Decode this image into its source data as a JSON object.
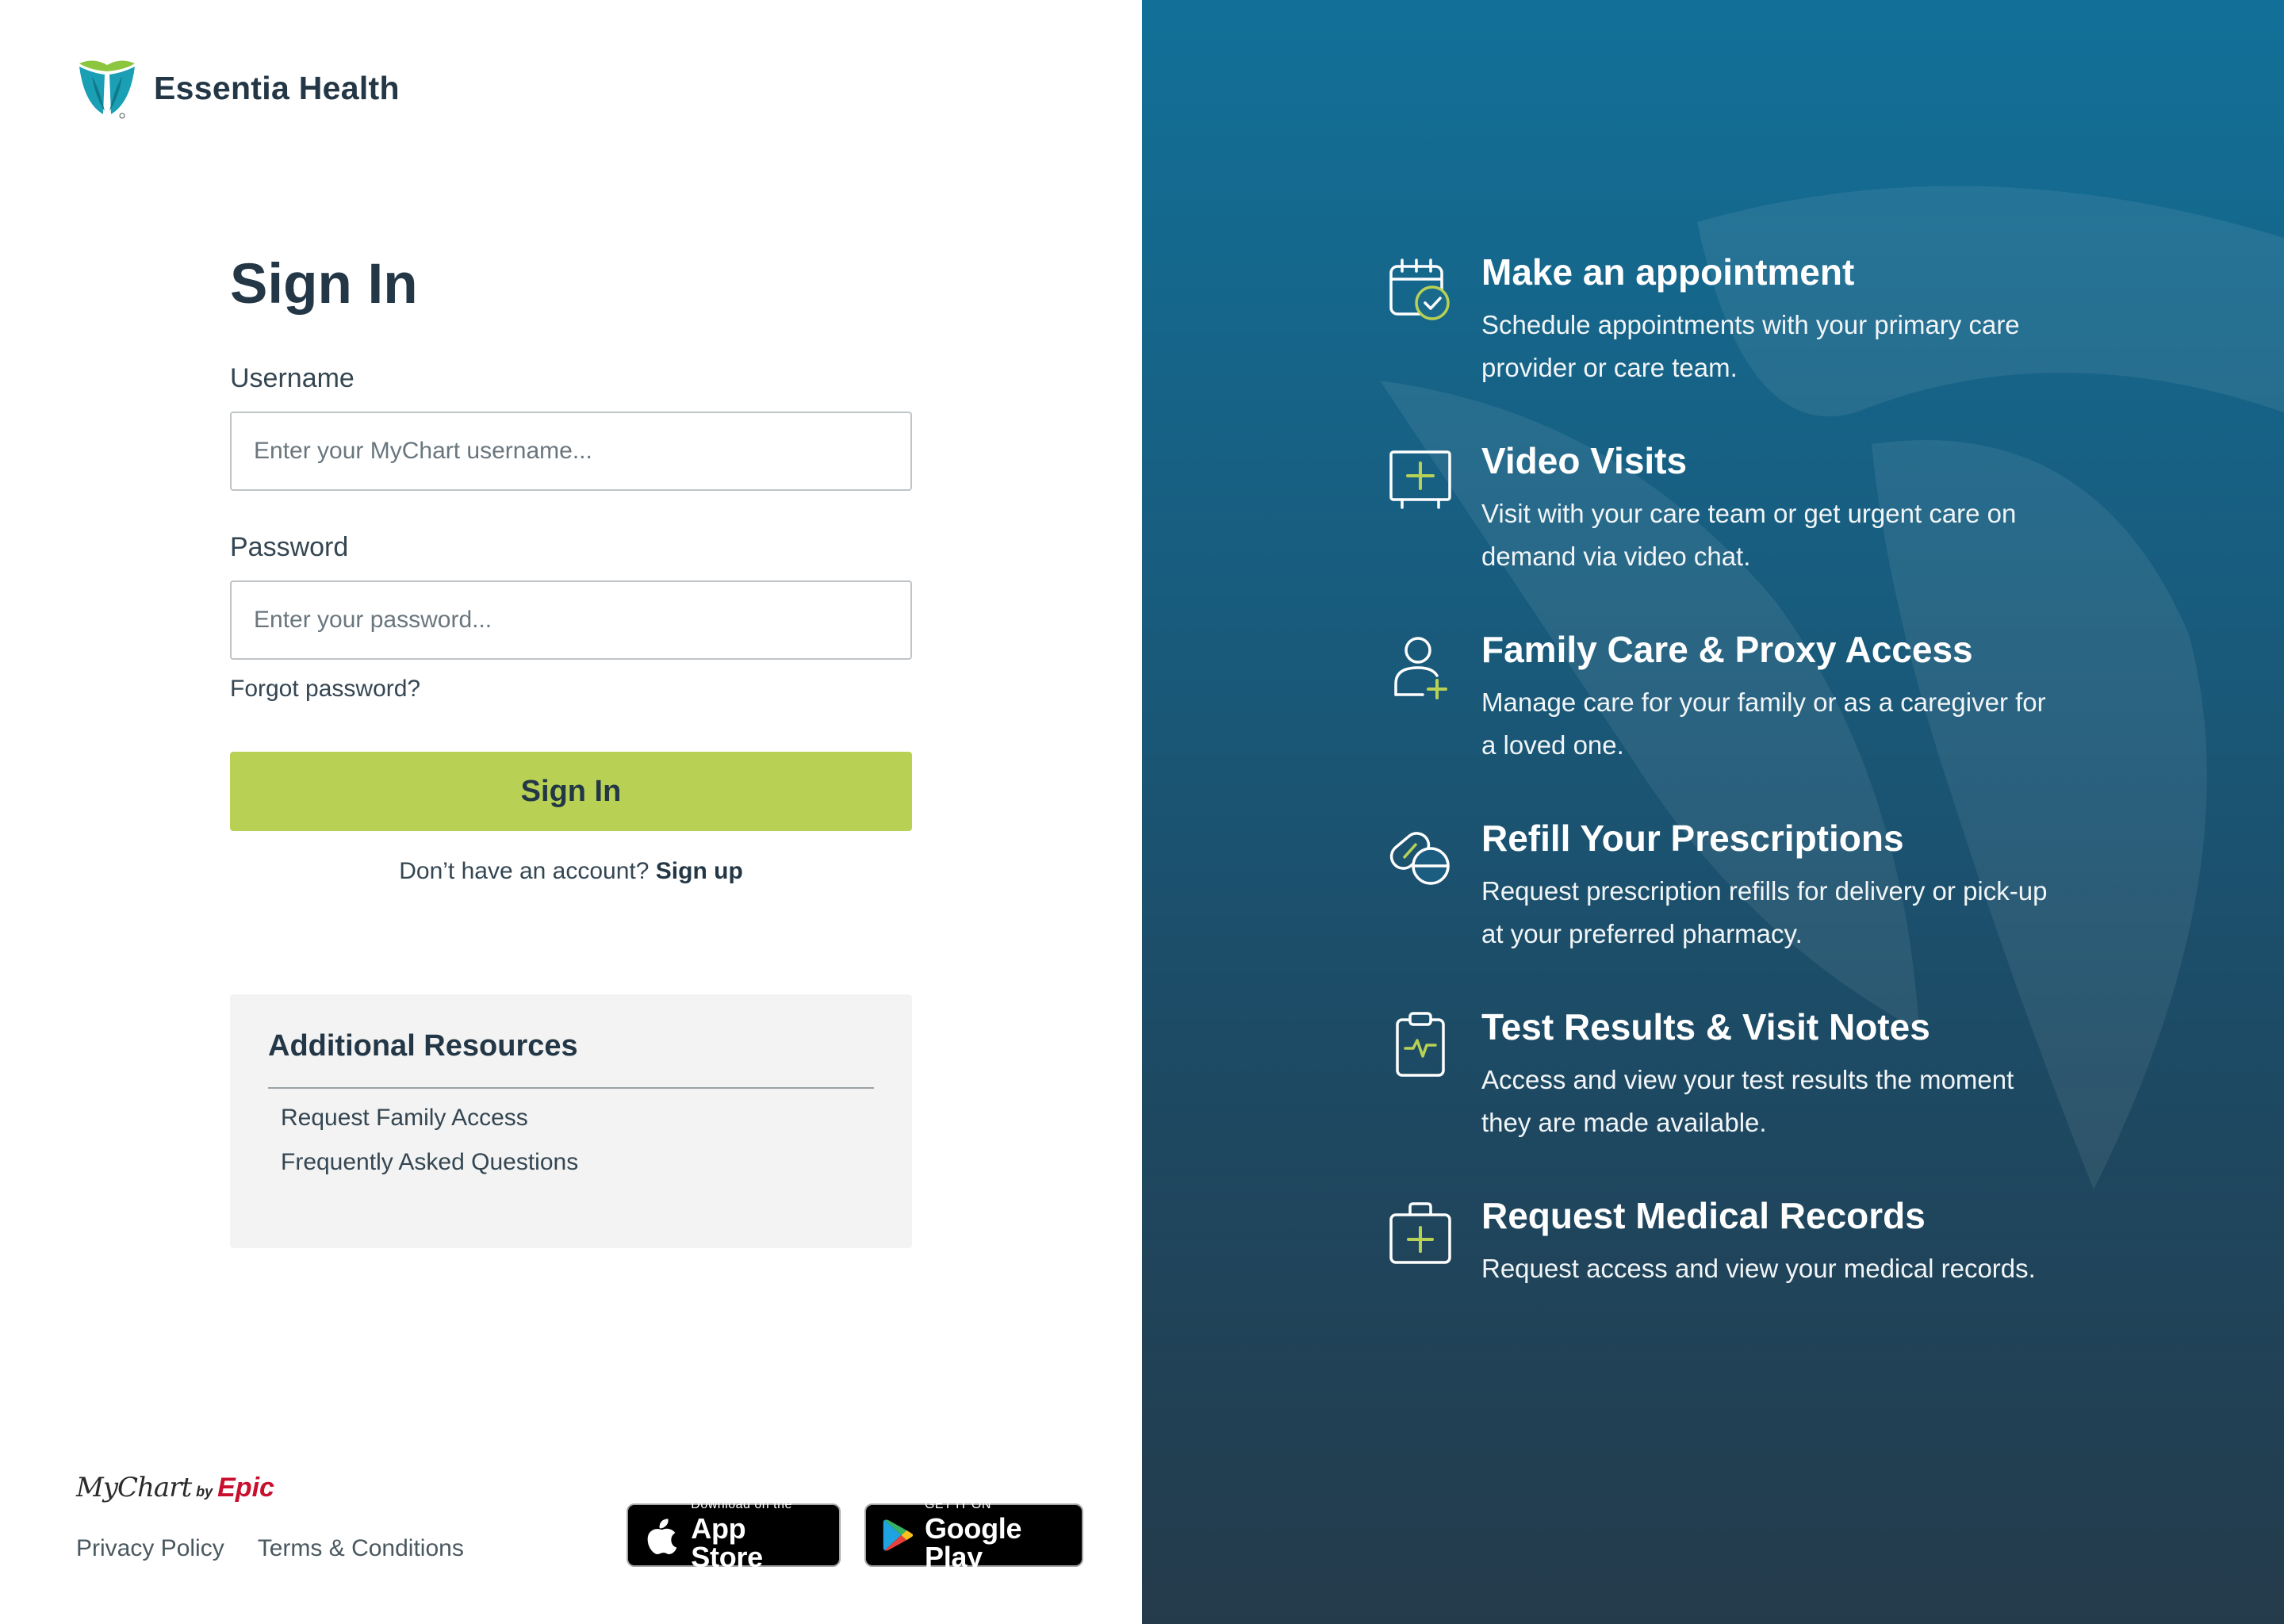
{
  "brand": {
    "name": "Essentia Health",
    "logo_icon": "essentia-leaf-logo",
    "colors": {
      "green": "#8cc63f",
      "teal": "#1a9fb5"
    }
  },
  "signin": {
    "title": "Sign In",
    "username_label": "Username",
    "username_placeholder": "Enter your MyChart username...",
    "username_value": "",
    "password_label": "Password",
    "password_placeholder": "Enter your password...",
    "password_value": "",
    "forgot_link": "Forgot password?",
    "button_label": "Sign In",
    "button_color": "#b8d155",
    "no_account_text": "Don’t have an account?",
    "signup_link": "Sign up"
  },
  "resources": {
    "title": "Additional Resources",
    "items": [
      {
        "label": "Request Family Access"
      },
      {
        "label": "Frequently Asked Questions"
      }
    ]
  },
  "footer": {
    "mychart": "MyChart",
    "by": "by",
    "epic": "Epic",
    "links": [
      {
        "label": "Privacy Policy"
      },
      {
        "label": "Terms & Conditions"
      }
    ],
    "app_store": {
      "small": "Download on the",
      "big": "App Store",
      "icon": "apple-icon"
    },
    "google_play": {
      "small": "GET IT ON",
      "big": "Google Play",
      "icon": "google-play-icon"
    }
  },
  "features": [
    {
      "icon": "calendar-check-icon",
      "title": "Make an appointment",
      "description": "Schedule appointments with your primary care provider or care team."
    },
    {
      "icon": "video-visit-icon",
      "title": "Video Visits",
      "description": "Visit with your care team or get urgent care on demand via video chat."
    },
    {
      "icon": "person-add-icon",
      "title": "Family Care & Proxy Access",
      "description": "Manage care for your family or as a caregiver for a loved one."
    },
    {
      "icon": "pills-icon",
      "title": "Refill Your Prescriptions",
      "description": "Request prescription refills for delivery or pick-up at your preferred pharmacy."
    },
    {
      "icon": "clipboard-pulse-icon",
      "title": "Test Results & Visit Notes",
      "description": "Access and view your test results the moment they are made available."
    },
    {
      "icon": "medical-kit-icon",
      "title": "Request Medical Records",
      "description": "Request access and view your medical records."
    }
  ],
  "colors": {
    "right_panel_top": "#127098",
    "right_panel_bottom": "#243b4b",
    "icon_accent": "#b8d155",
    "heading_text": "#233746"
  }
}
